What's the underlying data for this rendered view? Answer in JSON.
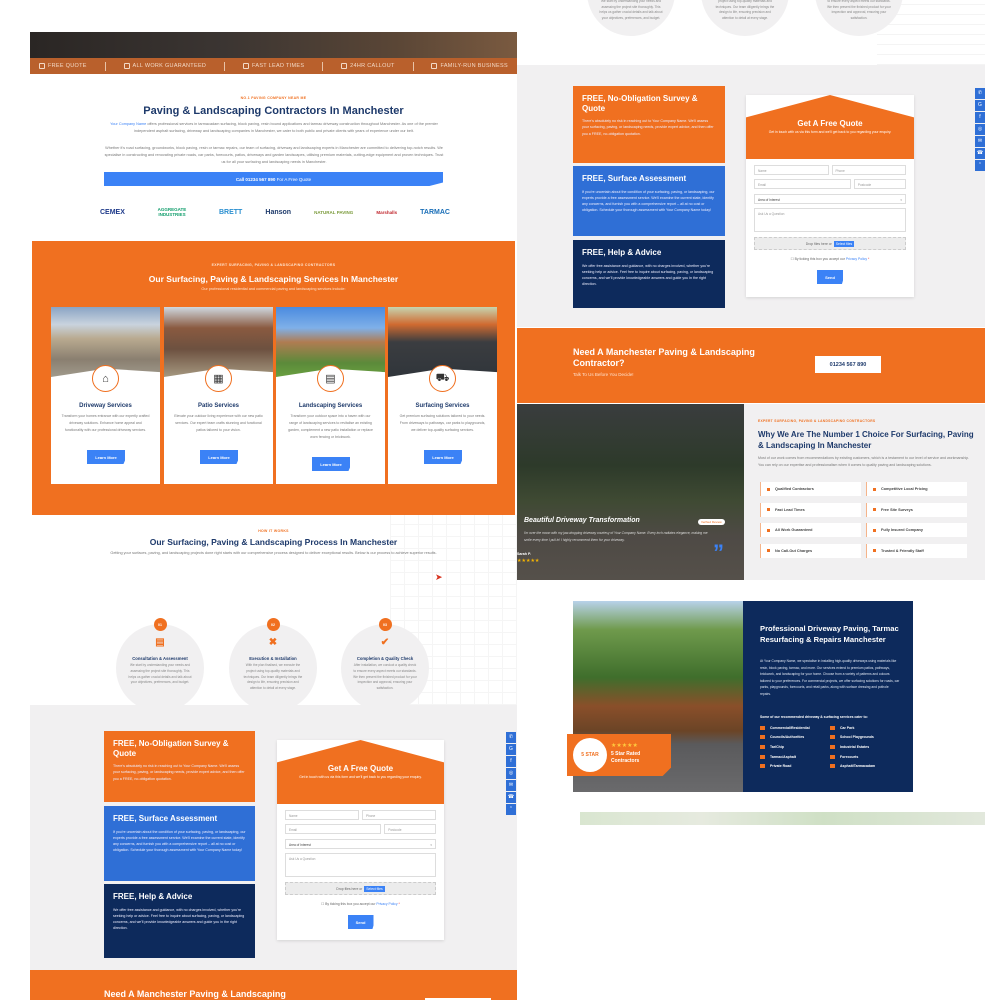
{
  "colors": {
    "orange": "#f07020",
    "blue": "#3b82f6",
    "navy": "#0d2a5c",
    "heading": "#1e3a6b",
    "grey_bg": "#f1f0f1"
  },
  "top_bar": {
    "features": [
      {
        "icon": "clipboard-icon",
        "label": "FREE QUOTE"
      },
      {
        "icon": "award-icon",
        "label": "ALL WORK GUARANTEED"
      },
      {
        "icon": "clock-icon",
        "label": "FAST LEAD TIMES"
      },
      {
        "icon": "calendar-icon",
        "label": "24HR CALLOUT"
      },
      {
        "icon": "family-icon",
        "label": "FAMILY-RUN BUSINESS"
      }
    ]
  },
  "intro": {
    "tag": "NO.1 PAVING COMPANY NEAR ME",
    "title": "Paving & Landscaping Contractors In Manchester",
    "company_link": "Your Company Name",
    "p1": " offers professional services in tarmacadam surfacing, block paving, resin bound applications and tarmac driveway construction throughout Manchester. As one of the premier independent asphalt surfacing, driveway and landscaping companies in Manchester, we cater to both public and private clients with years of experience under our belt.",
    "p2": "Whether it's road surfacing, groundworks, block paving, resin or tarmac repairs, our team of surfacing, driveway and landscaping experts in Manchester are committed to delivering top-notch results. We specialise in constructing and renovating private roads, car parks, forecourts, patios, driveways and garden landscapes, utilising premium materials, cutting-edge equipment and proven techniques. Trust us for all your surfacing and landscaping needs in Manchester.",
    "cta_prefix": "Call ",
    "cta_phone": "01234 567 890",
    "cta_suffix": " For A Free Quote"
  },
  "logos": [
    {
      "name": "CEMEX",
      "color": "#1e3a8a"
    },
    {
      "name": "AGGREGATE INDUSTRIES",
      "color": "#0f9d6b"
    },
    {
      "name": "BRETT",
      "color": "#2a8fd0"
    },
    {
      "name": "Hanson",
      "color": "#1e3a6b"
    },
    {
      "name": "NATURAL PAVING",
      "color": "#7a9a3a"
    },
    {
      "name": "Marshalls",
      "color": "#c0262d"
    },
    {
      "name": "TARMAC",
      "color": "#1a6fb8"
    }
  ],
  "services": {
    "tag": "EXPERT SURFACING, PAVING & LANDSCAPING CONTRACTORS",
    "title": "Our Surfacing, Paving & Landscaping Services In Manchester",
    "subtitle": "Our professional residential and commercial paving and landscaping services include:",
    "cards": [
      {
        "title": "Driveway Services",
        "icon": "house-driveway-icon",
        "text": "Transform your homes entrance with our expertly crafted driveway solutions. Enhance home appeal and functionality with our professional driveway services.",
        "button": "Learn More"
      },
      {
        "title": "Patio Services",
        "icon": "patio-doors-icon",
        "text": "Elevate your outdoor living experience with our new patio services. Our expert team crafts stunning and functional patios tailored to your vision.",
        "button": "Learn More"
      },
      {
        "title": "Landscaping Services",
        "icon": "garden-shed-icon",
        "text": "Transform your outdoor space into a haven with our range of landscaping services to revitalise an existing garden, complement a new patio installation or replace worn fencing or brickwork.",
        "button": "Learn More"
      },
      {
        "title": "Surfacing Services",
        "icon": "road-roller-icon",
        "text": "Get premium surfacing solutions tailored to your needs. From driveways to pathways, car parks to playgrounds, we deliver top-quality surfacing services.",
        "button": "Learn More"
      }
    ]
  },
  "process": {
    "tag": "HOW IT WORKS",
    "title": "Our Surfacing, Paving & Landscaping Process In Manchester",
    "subtitle": "Getting your surfaces, paving, and landscaping projects done right starts with our comprehensive process designed to deliver exceptional results. Below is our process to achieve superior results.",
    "steps": [
      {
        "num": "01",
        "icon": "clipboard-icon",
        "title": "Consultation & Assessment",
        "text": "We start by understanding your needs and assessing the project site thoroughly. This helps us gather crucial details and talk about your objectives, preferences, and budget."
      },
      {
        "num": "02",
        "icon": "tools-icon",
        "title": "Execution & Installation",
        "text": "With the plan finalised, we execute the project using top-quality materials and techniques. Our team diligently brings the design to life, ensuring precision and attention to detail at every stage."
      },
      {
        "num": "03",
        "icon": "checkmark-icon",
        "title": "Completion & Quality Check",
        "text": "After installation, we conduct a quality check to ensure every aspect meets our standards. We then present the finished product for your inspection and approval, ensuring your satisfaction."
      }
    ]
  },
  "quote": {
    "boxes": [
      {
        "title": "FREE, No-Obligation Survey & Quote",
        "text": "There's absolutely no risk in reaching out to Your Company Name. We'll assess your surfacing, paving, or landscaping needs, provide expert advice, and then offer you a FREE, no-obligation quotation.",
        "color": "#f07020"
      },
      {
        "title": "FREE, Surface Assessment",
        "text": "If you're uncertain about the condition of your surfacing, paving, or landscaping, our experts provide a free assessment service. We'll examine the current state, identify any concerns, and furnish you with a comprehensive report – all at no cost or obligation. Schedule your thorough assessment with Your Company Name today!",
        "color": "#2f6fd6"
      },
      {
        "title": "FREE, Help & Advice",
        "text": "We offer free assistance and guidance, with no charges involved, whether you're seeking help or advice. Feel free to inquire about surfacing, paving, or landscaping concerns, and we'll provide knowledgeable answers and guide you in the right direction.",
        "color": "#0d2a5c"
      }
    ],
    "form": {
      "title": "Get A Free Quote",
      "subtitle": "Get in touch with us via this form and we'll get back to you regarding your enquiry.",
      "name_placeholder": "Name",
      "phone_placeholder": "Phone",
      "email_placeholder": "Email",
      "postcode_placeholder": "Postcode",
      "area_selected": "Area of Interest",
      "question_placeholder": "Ask Us a Question",
      "drop_text": "Drop files here or",
      "select_files": "Select files",
      "consent_text": "By ticking this box you accept our",
      "privacy_link": "Privacy Policy",
      "required_mark": "*",
      "send": "Send"
    }
  },
  "social": [
    {
      "icon": "whatsapp-icon",
      "glyph": "✆"
    },
    {
      "icon": "google-icon",
      "glyph": "G"
    },
    {
      "icon": "facebook-icon",
      "glyph": "f"
    },
    {
      "icon": "instagram-icon",
      "glyph": "◎"
    },
    {
      "icon": "email-icon",
      "glyph": "✉"
    },
    {
      "icon": "phone-icon",
      "glyph": "☎"
    },
    {
      "icon": "scroll-top-icon",
      "glyph": "⌃"
    }
  ],
  "cta": {
    "title": "Need A Manchester Paving & Landscaping Contractor?",
    "subtitle": "Talk To Us Before You Decide!",
    "phone": "01234 567 890"
  },
  "why": {
    "testimonial": {
      "title": "Beautiful Driveway Transformation",
      "badge": "Verified Review",
      "quote": "I'm over the moon with my jaw-dropping driveway courtesy of Your Company Name. Every inch radiates elegance, making me smile every time I pull in! I highly recommend them for your driveway.",
      "author": "Sarah P.",
      "stars": "★★★★★",
      "rating": 5
    },
    "tag": "EXPERT SURFACING, PAVING & LANDSCAPING CONTRACTORS",
    "title": "Why We Are The Number 1 Choice For Surfacing, Paving & Landscaping In Manchester",
    "text": "Most of our work comes from recommendations by existing customers, which is a testament to our level of service and workmanship. You can rely on our expertise and professionalism when it comes to quality paving and landscaping solutions.",
    "features": [
      "Qualified Contractors",
      "Competitive Local Pricing",
      "Fast Lead Times",
      "Free Site Surveys",
      "All Work Guaranteed",
      "Fully Insured Company",
      "No Call-Out Charges",
      "Trusted & Friendly Staff"
    ]
  },
  "driveway": {
    "title": "Professional Driveway Paving, Tarmac Resurfacing & Repairs Manchester",
    "text": "At Your Company Name, we specialise in installing high-quality driveways using materials like resin, block paving, tarmac, and more. Our services extend to premium patios, pathways, brickwork, and landscaping for your home. Choose from a variety of patterns and colours tailored to your preferences. For commercial projects, we offer surfacing solutions for roads, car parks, playgrounds, forecourts, and retail parks, along with surface dressing and pothole repairs.",
    "list_title": "Some of our recommended driveway & surfacing services cater to:",
    "items": [
      "Commercial/Residential",
      "Car Park",
      "Councils/Authorities",
      "School Playgrounds",
      "Tar/Chip",
      "Industrial Estates",
      "Tarmac/Asphalt",
      "Forecourts",
      "Private Road",
      "Asphalt/Tarmacadam"
    ],
    "badge": {
      "stars": "★★★★★",
      "rating": 5,
      "label": "5 Star Rated Contractors",
      "seal": "5 STAR"
    }
  }
}
